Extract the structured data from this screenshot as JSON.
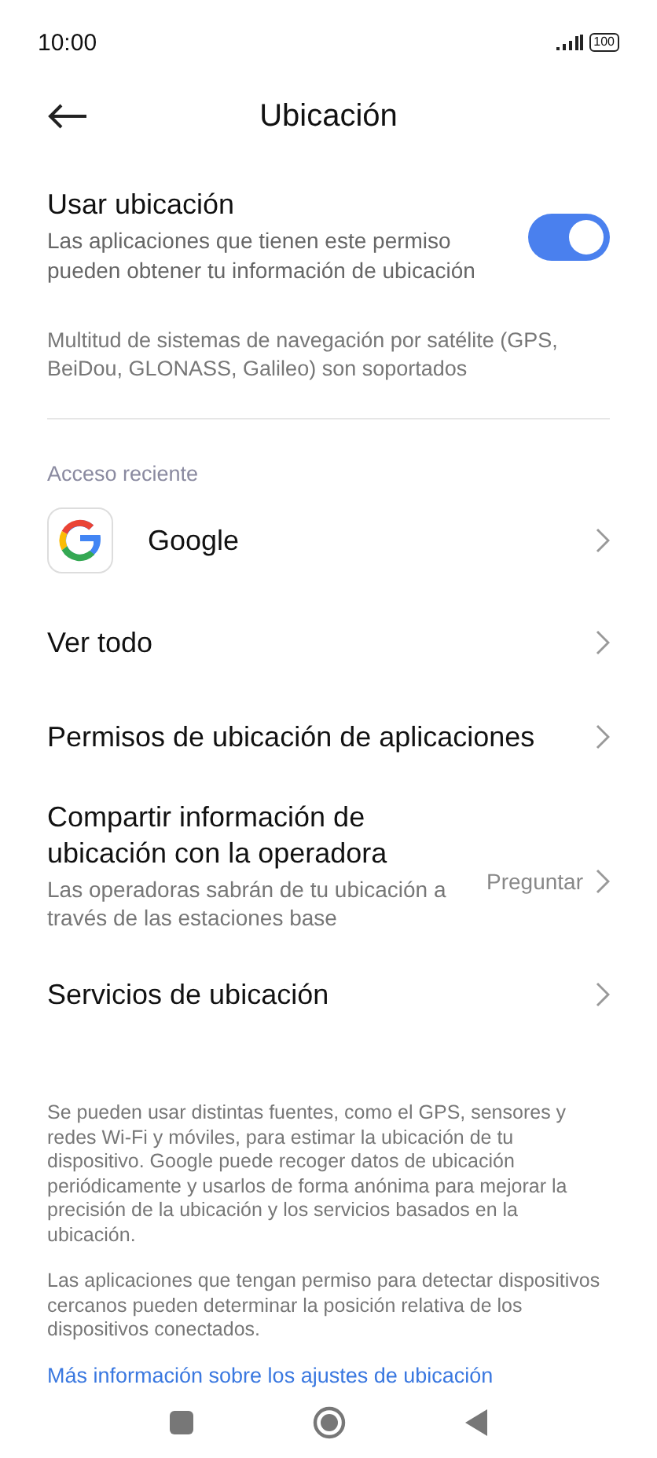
{
  "status_bar": {
    "time": "10:00",
    "battery": "100"
  },
  "header": {
    "title": "Ubicación"
  },
  "location_toggle": {
    "title": "Usar ubicación",
    "subtitle": "Las aplicaciones que tienen este permiso pueden obtener tu información de ubicación",
    "on": true
  },
  "gnss_note": "Multitud de sistemas de navegación por satélite (GPS, BeiDou, GLONASS, Galileo) son soportados",
  "section_label": "Acceso reciente",
  "items": [
    {
      "kind": "app",
      "title": "Google"
    },
    {
      "kind": "plain",
      "title": "Ver todo"
    },
    {
      "kind": "plain",
      "title": "Permisos de ubicación de aplicaciones"
    },
    {
      "kind": "detail",
      "title": "Compartir información de ubicación con la operadora",
      "subtitle": "Las operadoras sabrán de tu ubicación a través de las estaciones base",
      "value": "Preguntar"
    },
    {
      "kind": "plain",
      "title": "Servicios de ubicación"
    }
  ],
  "footer_paragraphs": [
    "Se pueden usar distintas fuentes, como el GPS, sensores y redes Wi-Fi y móviles, para estimar la ubicación de tu dispositivo. Google puede recoger datos de ubicación periódicamente y usarlos de forma anónima para mejorar la precisión de la ubicación y los servicios basados en la ubicación.",
    "Las aplicaciones que tengan permiso para detectar dispositivos cercanos pueden determinar la posición relativa de los dispositivos conectados."
  ],
  "link": "Más información sobre los ajustes de ubicación"
}
